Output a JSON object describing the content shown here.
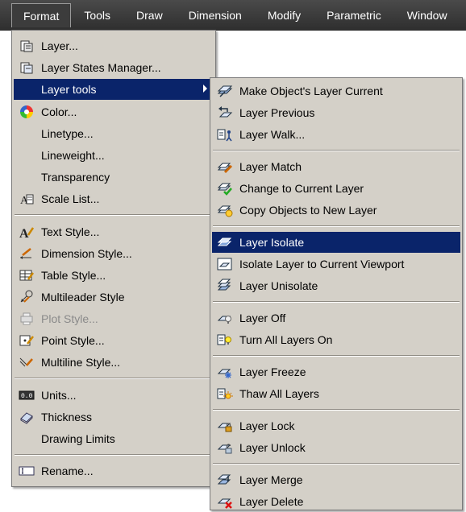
{
  "menubar": {
    "items": [
      "Format",
      "Tools",
      "Draw",
      "Dimension",
      "Modify",
      "Parametric",
      "Window"
    ]
  },
  "format_menu": {
    "items": [
      {
        "label": "Layer...",
        "icon": "layer-properties-icon"
      },
      {
        "label": "Layer States Manager...",
        "icon": "layer-states-icon"
      },
      {
        "label": "Layer tools",
        "icon": "",
        "highlighted": true,
        "submenu": true
      },
      {
        "label": "Color...",
        "icon": "color-wheel-icon"
      },
      {
        "label": "Linetype...",
        "icon": ""
      },
      {
        "label": "Lineweight...",
        "icon": ""
      },
      {
        "label": "Transparency",
        "icon": ""
      },
      {
        "label": "Scale List...",
        "icon": "scale-list-icon"
      },
      {
        "label": "Text Style...",
        "icon": "text-style-icon"
      },
      {
        "label": "Dimension Style...",
        "icon": "dimension-style-icon"
      },
      {
        "label": "Table Style...",
        "icon": "table-style-icon"
      },
      {
        "label": "Multileader Style",
        "icon": "multileader-style-icon"
      },
      {
        "label": "Plot Style...",
        "icon": "plot-style-icon",
        "disabled": true
      },
      {
        "label": "Point Style...",
        "icon": "point-style-icon"
      },
      {
        "label": "Multiline Style...",
        "icon": "multiline-style-icon"
      },
      {
        "label": "Units...",
        "icon": "units-icon"
      },
      {
        "label": "Thickness",
        "icon": "thickness-icon"
      },
      {
        "label": "Drawing Limits",
        "icon": ""
      },
      {
        "label": "Rename...",
        "icon": "rename-icon"
      }
    ]
  },
  "layer_tools_menu": {
    "items": [
      {
        "label": "Make Object's Layer Current",
        "icon": "make-layer-current-icon"
      },
      {
        "label": "Layer Previous",
        "icon": "layer-previous-icon"
      },
      {
        "label": "Layer Walk...",
        "icon": "layer-walk-icon"
      },
      {
        "label": "Layer Match",
        "icon": "layer-match-icon"
      },
      {
        "label": "Change to Current Layer",
        "icon": "change-to-current-layer-icon"
      },
      {
        "label": "Copy Objects to New Layer",
        "icon": "copy-objects-to-new-layer-icon"
      },
      {
        "label": "Layer Isolate",
        "icon": "layer-isolate-icon",
        "highlighted": true
      },
      {
        "label": "Isolate Layer to Current Viewport",
        "icon": "isolate-viewport-icon"
      },
      {
        "label": "Layer Unisolate",
        "icon": "layer-unisolate-icon"
      },
      {
        "label": "Layer Off",
        "icon": "layer-off-icon"
      },
      {
        "label": "Turn All Layers On",
        "icon": "turn-all-layers-on-icon"
      },
      {
        "label": "Layer Freeze",
        "icon": "layer-freeze-icon"
      },
      {
        "label": "Thaw All Layers",
        "icon": "thaw-all-layers-icon"
      },
      {
        "label": "Layer Lock",
        "icon": "layer-lock-icon"
      },
      {
        "label": "Layer Unlock",
        "icon": "layer-unlock-icon"
      },
      {
        "label": "Layer Merge",
        "icon": "layer-merge-icon"
      },
      {
        "label": "Layer Delete",
        "icon": "layer-delete-icon"
      }
    ]
  },
  "colors": {
    "menubar_bg": "#3a3a3a",
    "menu_bg": "#d4d0c8",
    "highlight": "#0a246a"
  }
}
